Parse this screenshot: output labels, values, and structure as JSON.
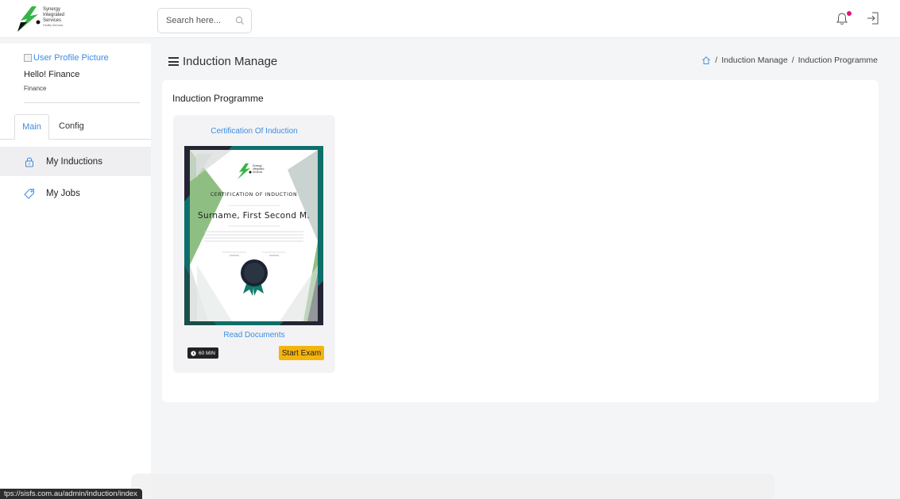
{
  "header": {
    "logo_lines": [
      "Synergy",
      "Integrated",
      "Services"
    ],
    "logo_tagline": "Facility Services",
    "search_placeholder": "Search here..."
  },
  "colors": {
    "accent": "#3b8de0",
    "notification_dot": "#e1147a",
    "exam_button": "#f5b40d",
    "logo_green": "#38b449"
  },
  "sidebar": {
    "avatar_alt": "User Profile Picture",
    "greeting": "Hello! Finance",
    "role": "Finance",
    "tabs": [
      {
        "label": "Main",
        "active": true
      },
      {
        "label": "Config",
        "active": false
      }
    ],
    "items": [
      {
        "label": "My Inductions",
        "icon": "lock-icon",
        "active": true
      },
      {
        "label": "My Jobs",
        "icon": "tag-icon",
        "active": false
      }
    ]
  },
  "page": {
    "title": "Induction Manage",
    "breadcrumb": {
      "items": [
        "Induction Manage",
        "Induction Programme"
      ],
      "separator": "/"
    },
    "section_title": "Induction Programme"
  },
  "course": {
    "title": "Certification Of Induction",
    "certificate": {
      "heading": "CERTIFICATION OF INDUCTION",
      "name": "Surname, First Second  M.",
      "logo_lines": [
        "Synergy",
        "Integrated",
        "Services"
      ]
    },
    "read_documents": "Read Documents",
    "duration": "60 MIN",
    "start_exam": "Start Exam"
  },
  "status_url": "tps://sisfs.com.au/admin/induction/index"
}
